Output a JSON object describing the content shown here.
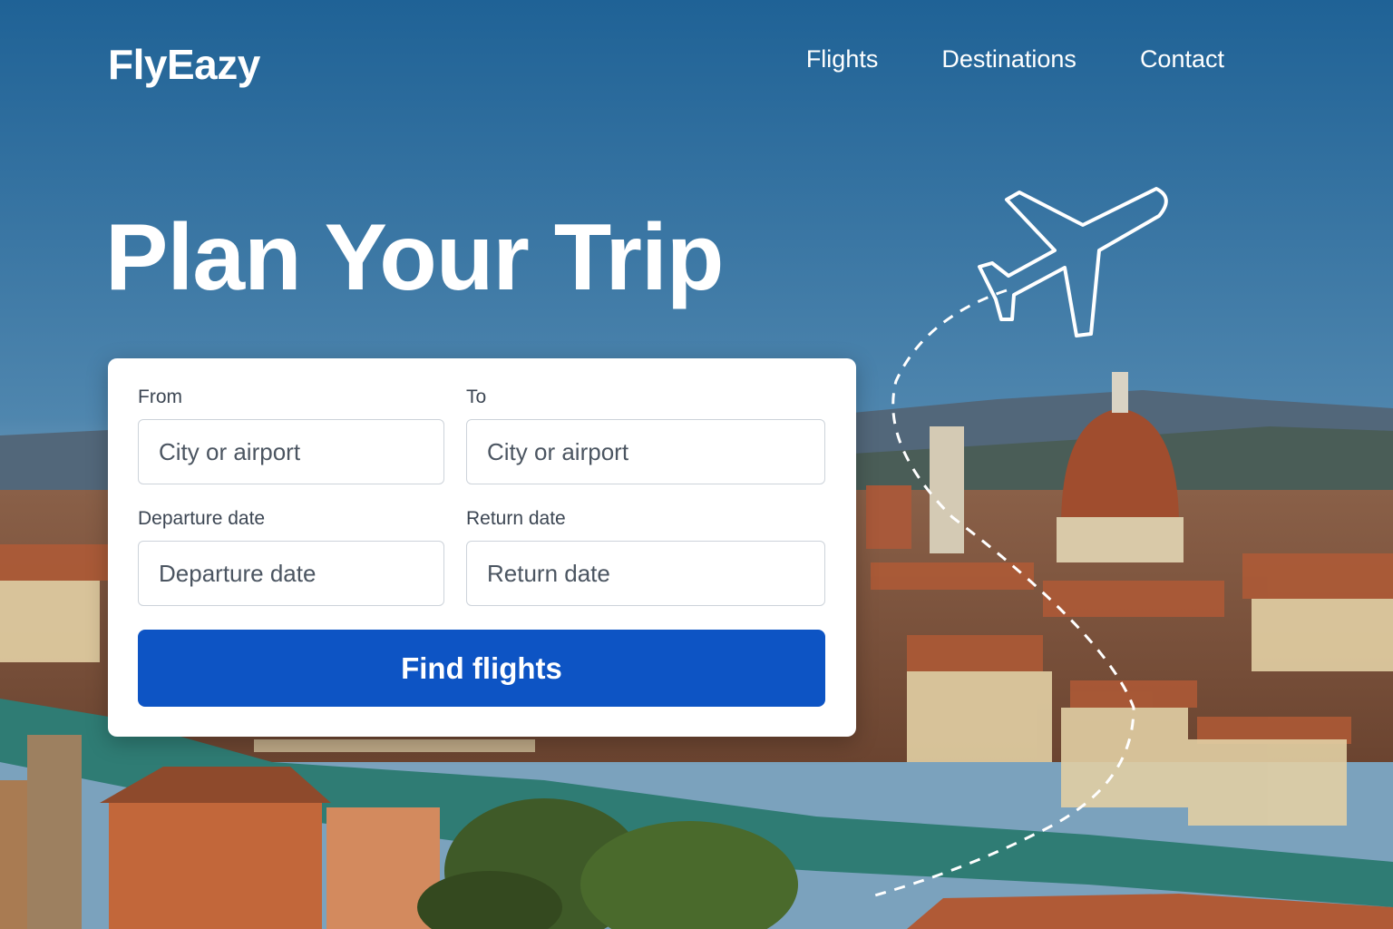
{
  "brand": {
    "name": "FlyEazy"
  },
  "nav": [
    {
      "label": "Flights"
    },
    {
      "label": "Destinations"
    },
    {
      "label": "Contact"
    }
  ],
  "hero": {
    "title": "Plan Your Trip"
  },
  "search_form": {
    "from": {
      "label": "From",
      "placeholder": "City or airport"
    },
    "to": {
      "label": "To",
      "placeholder": "City or airport"
    },
    "departure": {
      "label": "Departure date",
      "placeholder": "Departure date"
    },
    "return": {
      "label": "Return date",
      "placeholder": "Return date"
    },
    "submit_label": "Find flights"
  },
  "colors": {
    "primary_button": "#0d54c4",
    "sky": "#2c6a98",
    "card": "#ffffff"
  }
}
